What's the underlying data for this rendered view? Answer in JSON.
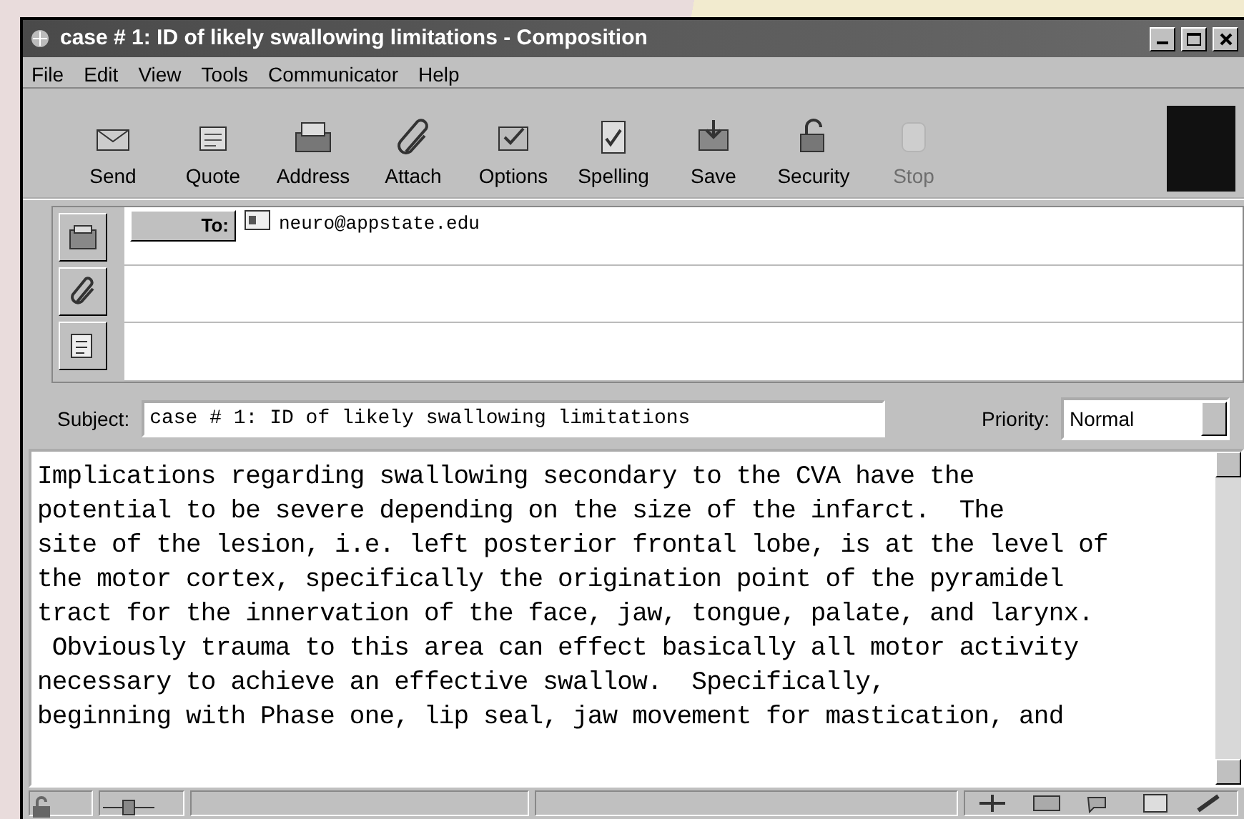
{
  "window": {
    "title": "case # 1: ID of likely swallowing limitations - Composition"
  },
  "menu": [
    "File",
    "Edit",
    "View",
    "Tools",
    "Communicator",
    "Help"
  ],
  "toolbar": [
    {
      "label": "Send",
      "kind": "send",
      "disabled": false
    },
    {
      "label": "Quote",
      "kind": "quote",
      "disabled": false
    },
    {
      "label": "Address",
      "kind": "address",
      "disabled": false
    },
    {
      "label": "Attach",
      "kind": "attach",
      "disabled": false
    },
    {
      "label": "Options",
      "kind": "options",
      "disabled": false
    },
    {
      "label": "Spelling",
      "kind": "spelling",
      "disabled": false
    },
    {
      "label": "Save",
      "kind": "save",
      "disabled": false
    },
    {
      "label": "Security",
      "kind": "security",
      "disabled": false
    },
    {
      "label": "Stop",
      "kind": "stop",
      "disabled": true
    }
  ],
  "addressing": {
    "recipients": [
      {
        "field": "To:",
        "address": "neuro@appstate.edu"
      }
    ]
  },
  "subject": {
    "label": "Subject:",
    "value": "case # 1: ID of likely swallowing limitations"
  },
  "priority": {
    "label": "Priority:",
    "value": "Normal"
  },
  "body": {
    "lines": [
      "Implications regarding swallowing secondary to the CVA have the",
      "potential to be severe depending on the size of the infarct.  The",
      "site of the lesion, i.e. left posterior frontal lobe, is at the level of",
      "the motor cortex, specifically the origination point of the pyramidel",
      "tract for the innervation of the face, jaw, tongue, palate, and larynx.",
      " Obviously trauma to this area can effect basically all motor activity",
      "necessary to achieve an effective swallow.  Specifically,",
      "beginning with Phase one, lip seal, jaw movement for mastication, and"
    ]
  }
}
